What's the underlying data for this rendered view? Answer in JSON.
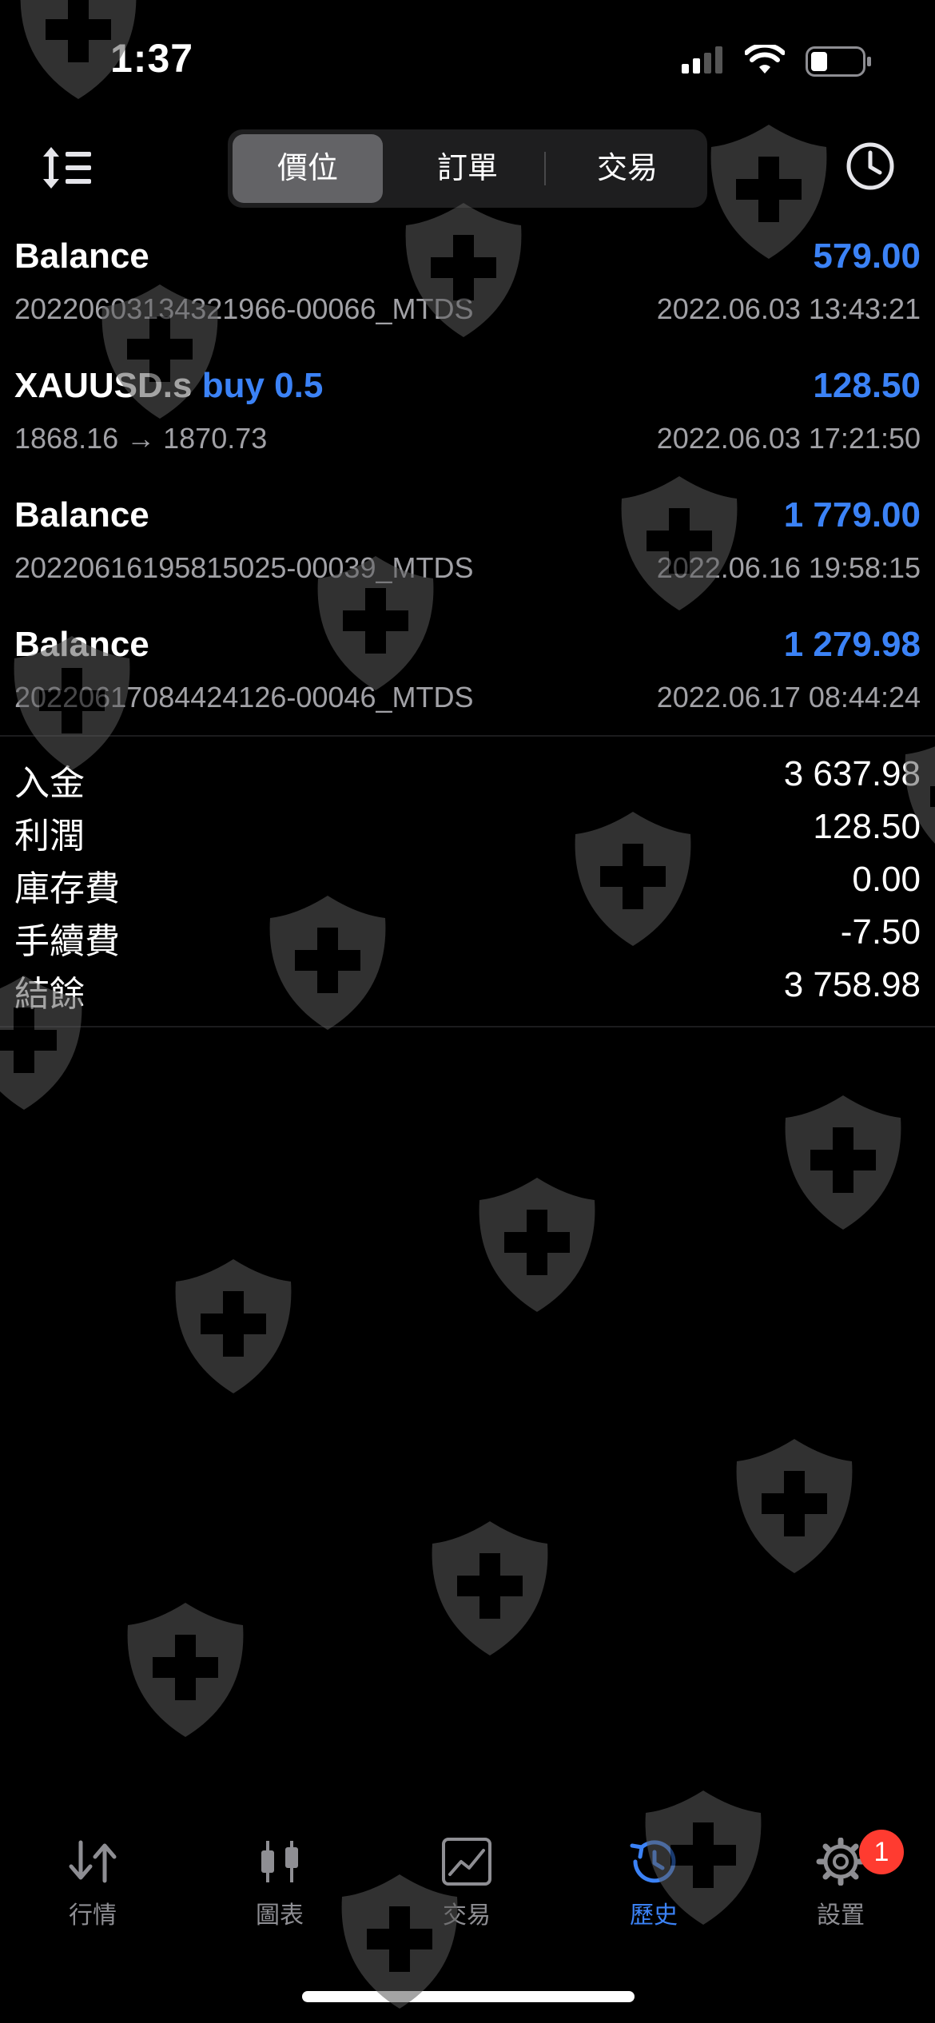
{
  "status_bar": {
    "time": "1:37"
  },
  "header": {
    "segments": [
      "價位",
      "訂單",
      "交易"
    ],
    "active_segment": "價位"
  },
  "deals": [
    {
      "title": "Balance",
      "direction": "",
      "amount": "579.00",
      "comment": "20220603134321966-00066_MTDS",
      "time": "2022.06.03 13:43:21"
    },
    {
      "title": "XAUUSD.s",
      "direction": "buy 0.5",
      "amount": "128.50",
      "comment": "1868.16 → 1870.73",
      "time": "2022.06.03 17:21:50"
    },
    {
      "title": "Balance",
      "direction": "",
      "amount": "1 779.00",
      "comment": "20220616195815025-00039_MTDS",
      "time": "2022.06.16 19:58:15"
    },
    {
      "title": "Balance",
      "direction": "",
      "amount": "1 279.98",
      "comment": "20220617084424126-00046_MTDS",
      "time": "2022.06.17 08:44:24"
    }
  ],
  "summary": [
    {
      "label": "入金",
      "value": "3 637.98"
    },
    {
      "label": "利潤",
      "value": "128.50"
    },
    {
      "label": "庫存費",
      "value": "0.00"
    },
    {
      "label": "手續費",
      "value": "-7.50"
    },
    {
      "label": "結餘",
      "value": "3 758.98"
    }
  ],
  "tabbar": {
    "items": [
      {
        "label": "行情",
        "icon": "arrows-updown-icon"
      },
      {
        "label": "圖表",
        "icon": "candlestick-icon"
      },
      {
        "label": "交易",
        "icon": "line-chart-icon"
      },
      {
        "label": "歷史",
        "icon": "history-icon"
      },
      {
        "label": "設置",
        "icon": "gear-icon"
      }
    ],
    "active": "歷史",
    "settings_badge": "1"
  },
  "colors": {
    "accent": "#3b82f6",
    "background": "#000000",
    "badge": "#ff3b30"
  }
}
